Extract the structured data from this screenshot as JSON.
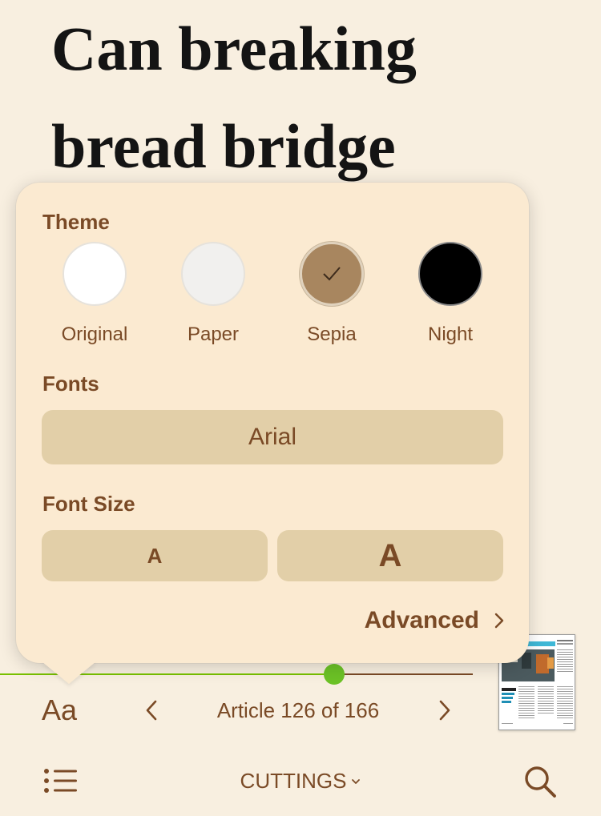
{
  "article": {
    "title_line1": "Can breaking",
    "title_line2": "bread bridge"
  },
  "popover": {
    "theme_label": "Theme",
    "themes": [
      {
        "label": "Original",
        "color": "#ffffff",
        "selected": false
      },
      {
        "label": "Paper",
        "color": "#f1f0ee",
        "selected": false
      },
      {
        "label": "Sepia",
        "color": "#a8865f",
        "selected": true
      },
      {
        "label": "Night",
        "color": "#000000",
        "selected": false
      }
    ],
    "fonts_label": "Fonts",
    "font_value": "Arial",
    "font_size_label": "Font Size",
    "font_smaller_label": "A",
    "font_larger_label": "A",
    "advanced_label": "Advanced"
  },
  "reader": {
    "progress_fraction": 0.707,
    "aa_label": "Aa",
    "counter": "Article 126 of 166",
    "section": "CUTTINGS"
  },
  "colors": {
    "background": "#f8efe0",
    "popover": "#fbead1",
    "accent": "#7a4a26",
    "progress": "#79c000"
  }
}
